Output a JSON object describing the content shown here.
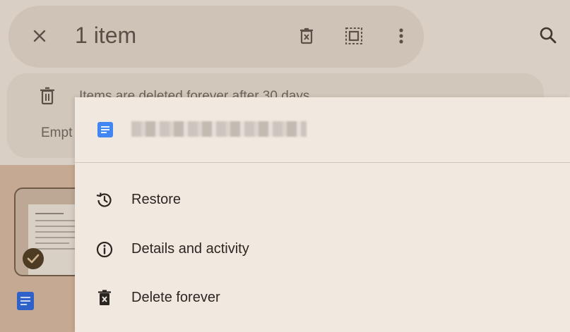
{
  "toolbar": {
    "selection_count": "1 item",
    "close_icon": "close-icon",
    "delete_icon": "delete-forever-icon",
    "select_all_icon": "select-all-icon",
    "more_icon": "more-vert-icon",
    "search_icon": "search-icon"
  },
  "banner": {
    "message": "Items are deleted forever after 30 days",
    "action": "Empt",
    "icon": "trash-icon"
  },
  "file_card": {
    "selected": true,
    "check_icon": "check-icon",
    "type_icon": "google-docs-icon"
  },
  "menu": {
    "header_icon": "google-docs-icon",
    "items": [
      {
        "label": "Restore",
        "icon": "restore-history-icon"
      },
      {
        "label": "Details and activity",
        "icon": "info-icon"
      },
      {
        "label": "Delete forever",
        "icon": "delete-forever-icon"
      }
    ]
  },
  "colors": {
    "sheet_background": "#f1e9e0",
    "doc_blue": "#4285f4",
    "scrim_tint": "#c6a993"
  }
}
